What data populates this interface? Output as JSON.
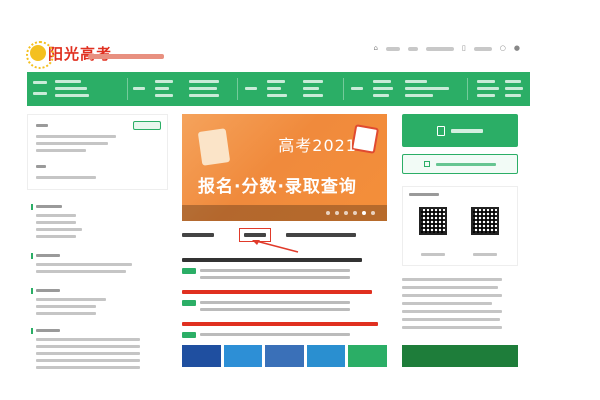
{
  "brand": {
    "name": "阳光高考",
    "color": "#e03020"
  },
  "nav": {
    "background": "#2bae66",
    "items": []
  },
  "banner": {
    "title": "高考2021",
    "subtitle": "报名·分数·录取查询",
    "slide_count": 6,
    "active_slide": 5
  },
  "main": {
    "highlighted_tab_color": "#e03a2a",
    "news": []
  },
  "sidebar": {},
  "colors": {
    "accent_green": "#2bae66",
    "accent_red": "#e03020",
    "highlight_red": "#e03a2a",
    "light_green_bg": "#f2fbf6"
  },
  "icons": [
    "logo-sun-icon",
    "mobile-icon",
    "weibo-icon",
    "wechat-icon",
    "document-icon",
    "search-icon",
    "qr-code-icon"
  ]
}
